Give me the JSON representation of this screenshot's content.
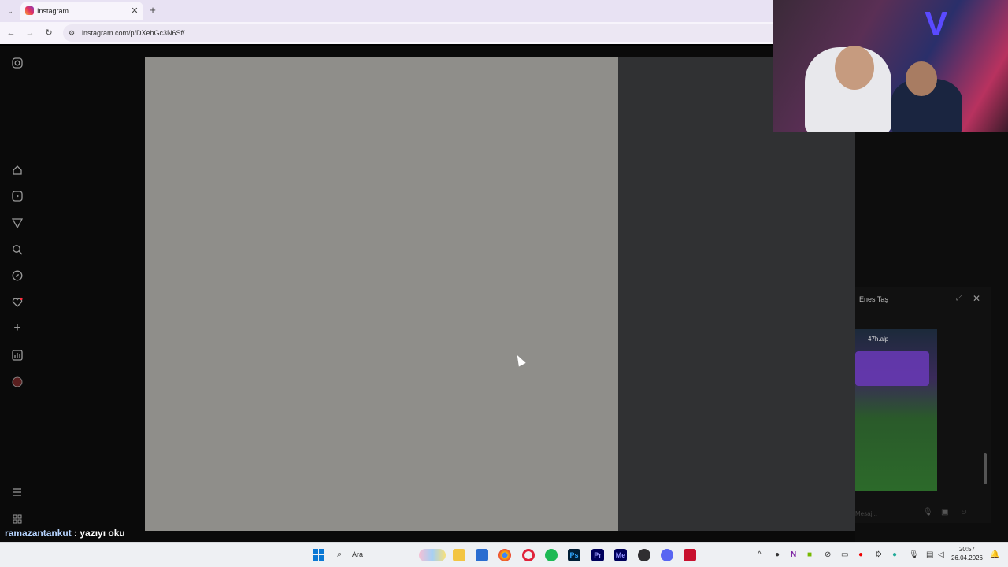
{
  "browser": {
    "tab_title": "Instagram",
    "tab_close_icon": "close-icon",
    "new_tab_icon": "plus-icon",
    "url": "instagram.com/p/DXehGc3N6Sf/"
  },
  "sidebar": {
    "icons": [
      "instagram-icon",
      "home-icon",
      "reels-icon",
      "send-icon",
      "search-icon",
      "explore-icon",
      "heart-icon",
      "create-icon",
      "dashboard-icon",
      "profile-icon",
      "menu-icon",
      "also-from-meta-icon"
    ]
  },
  "chat_panel": {
    "contact_name": "Enes Taş",
    "post_author": "47h.alp",
    "message_placeholder": "Mesaj..."
  },
  "stream_chat": {
    "username": "ramazantankut",
    "separator": " : ",
    "message": "yazıyı oku"
  },
  "taskbar": {
    "search_placeholder": "Ara",
    "time": "20:57",
    "date": "26.04.2026"
  },
  "colors": {
    "overlay": "#303133",
    "media_placeholder": "#8f8e8a",
    "tab_bar": "#e8e2f3"
  }
}
